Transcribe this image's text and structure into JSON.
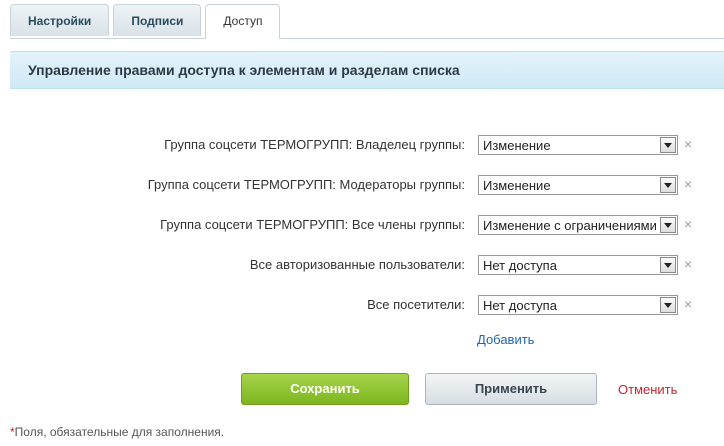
{
  "tabs": [
    {
      "label": "Настройки",
      "active": false
    },
    {
      "label": "Подписи",
      "active": false
    },
    {
      "label": "Доступ",
      "active": true
    }
  ],
  "section": {
    "title": "Управление правами доступа к элементам и разделам списка"
  },
  "rows": [
    {
      "label": "Группа соцсети ТЕРМОГРУПП: Владелец группы:",
      "value": "Изменение"
    },
    {
      "label": "Группа соцсети ТЕРМОГРУПП: Модераторы группы:",
      "value": "Изменение"
    },
    {
      "label": "Группа соцсети ТЕРМОГРУПП: Все члены группы:",
      "value": "Изменение с ограничениями"
    },
    {
      "label": "Все авторизованные пользователи:",
      "value": "Нет доступа"
    },
    {
      "label": "Все посетители:",
      "value": "Нет доступа"
    }
  ],
  "remove_glyph": "×",
  "add_link": "Добавить",
  "buttons": {
    "save": "Сохранить",
    "apply": "Применить",
    "cancel": "Отменить"
  },
  "footnote": {
    "star": "*",
    "text": "Поля, обязательные для заполнения."
  },
  "colors": {
    "accent_green": "#7db51f",
    "link_blue": "#2066b0",
    "cancel_red": "#c0272d",
    "header_bg": "#d0e9f6"
  },
  "icons": [
    "chevron-down-icon",
    "close-icon"
  ]
}
